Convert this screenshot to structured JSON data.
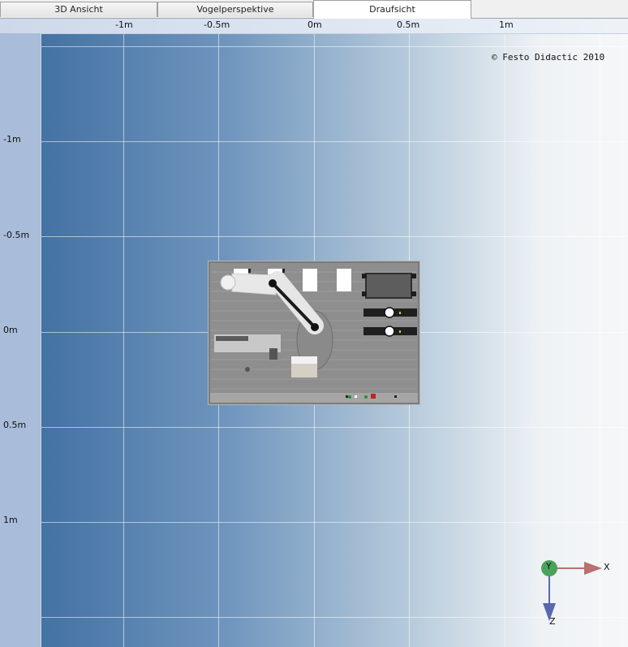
{
  "tabs": [
    {
      "label": "3D Ansicht",
      "active": false
    },
    {
      "label": "Vogelperspektive",
      "active": false
    },
    {
      "label": "Draufsicht",
      "active": true
    }
  ],
  "viewport": {
    "view": "Draufsicht",
    "x_ticks": [
      "-1m",
      "-0.5m",
      "0m",
      "0.5m",
      "1m"
    ],
    "y_ticks": [
      "-1m",
      "-0.5m",
      "0m",
      "0.5m",
      "1m"
    ],
    "copyright": "© Festo Didactic 2010",
    "colors": {
      "background_left": "#3a6a9e",
      "background_right": "#f6f7f8",
      "grid": "#ffffff"
    }
  },
  "axis_gizmo": {
    "labels": {
      "x": "X",
      "y": "Y",
      "z": "Z"
    },
    "colors": {
      "x": "#b87070",
      "y": "#4aa35a",
      "z": "#5a66b0"
    }
  },
  "scene": {
    "object": "robot-workstation",
    "colors": {
      "table": "#8c8c8c",
      "robot_arm": "#e8e8e8",
      "link": "#1a1a1a"
    }
  }
}
